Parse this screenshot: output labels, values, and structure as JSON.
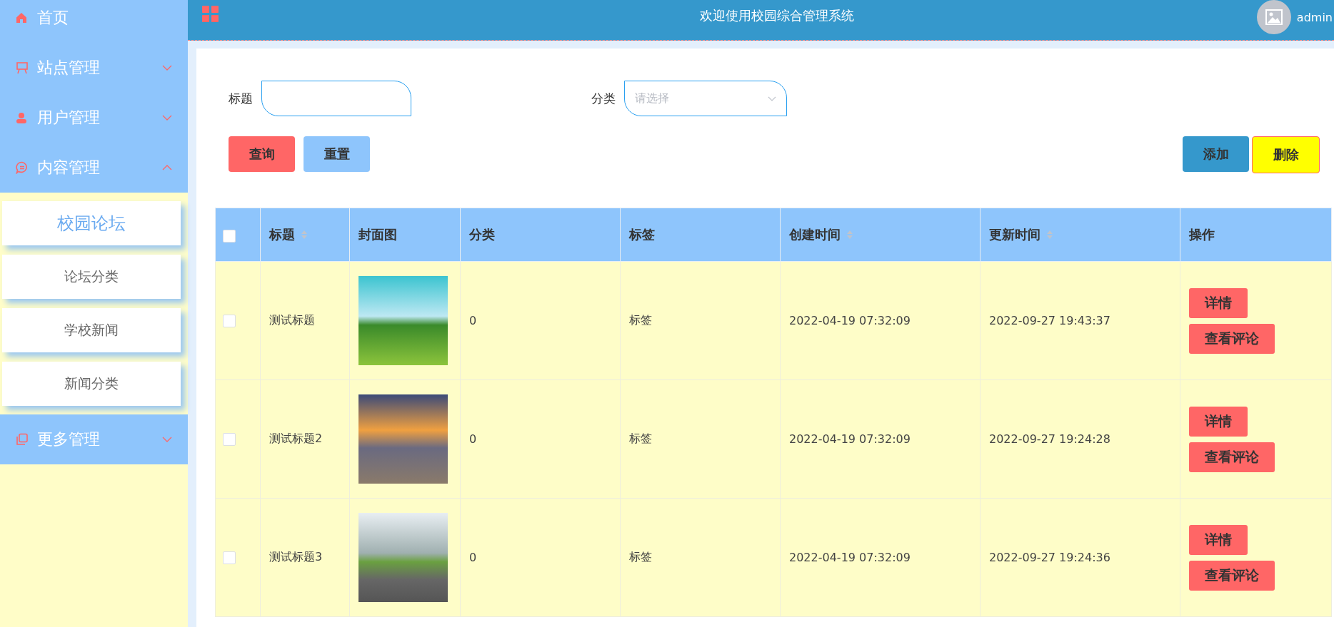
{
  "sidebar": {
    "items": [
      {
        "label": "首页"
      },
      {
        "label": "站点管理",
        "expanded": false
      },
      {
        "label": "用户管理",
        "expanded": false
      },
      {
        "label": "内容管理",
        "expanded": true,
        "children": [
          {
            "label": "校园论坛",
            "selected": true
          },
          {
            "label": "论坛分类",
            "selected": false
          },
          {
            "label": "学校新闻",
            "selected": false
          },
          {
            "label": "新闻分类",
            "selected": false
          }
        ]
      },
      {
        "label": "更多管理",
        "expanded": false
      }
    ]
  },
  "header": {
    "title": "欢迎使用校园综合管理系统",
    "user": "admin"
  },
  "filters": [
    {
      "label": "标题",
      "kind": "input"
    },
    {
      "label": "分类",
      "kind": "select",
      "placeholder": "请选择"
    }
  ],
  "search_buttons": [
    "查询",
    "重置"
  ],
  "action_buttons": [
    "添加",
    "删除"
  ],
  "table": {
    "all_checked": false,
    "columns": [
      {
        "label": "标题",
        "sortable": true
      },
      {
        "label": "封面图",
        "sortable": false
      },
      {
        "label": "分类",
        "sortable": false
      },
      {
        "label": "标签",
        "sortable": false
      },
      {
        "label": "创建时间",
        "sortable": true
      },
      {
        "label": "更新时间",
        "sortable": true
      },
      {
        "label": "操作",
        "sortable": false
      }
    ],
    "rows": [
      {
        "checked": false,
        "title": "测试标题",
        "category": "0",
        "tag": "标签",
        "created": "2022-04-19 07:32:09",
        "updated": "2022-09-27 19:43:37",
        "actions": [
          "详情",
          "查看评论"
        ]
      },
      {
        "checked": false,
        "title": "测试标题2",
        "category": "0",
        "tag": "标签",
        "created": "2022-04-19 07:32:09",
        "updated": "2022-09-27 19:24:28",
        "actions": [
          "详情",
          "查看评论"
        ]
      },
      {
        "checked": false,
        "title": "测试标题3",
        "category": "0",
        "tag": "标签",
        "created": "2022-04-19 07:32:09",
        "updated": "2022-09-27 19:24:36",
        "actions": [
          "详情",
          "查看评论"
        ]
      }
    ]
  }
}
